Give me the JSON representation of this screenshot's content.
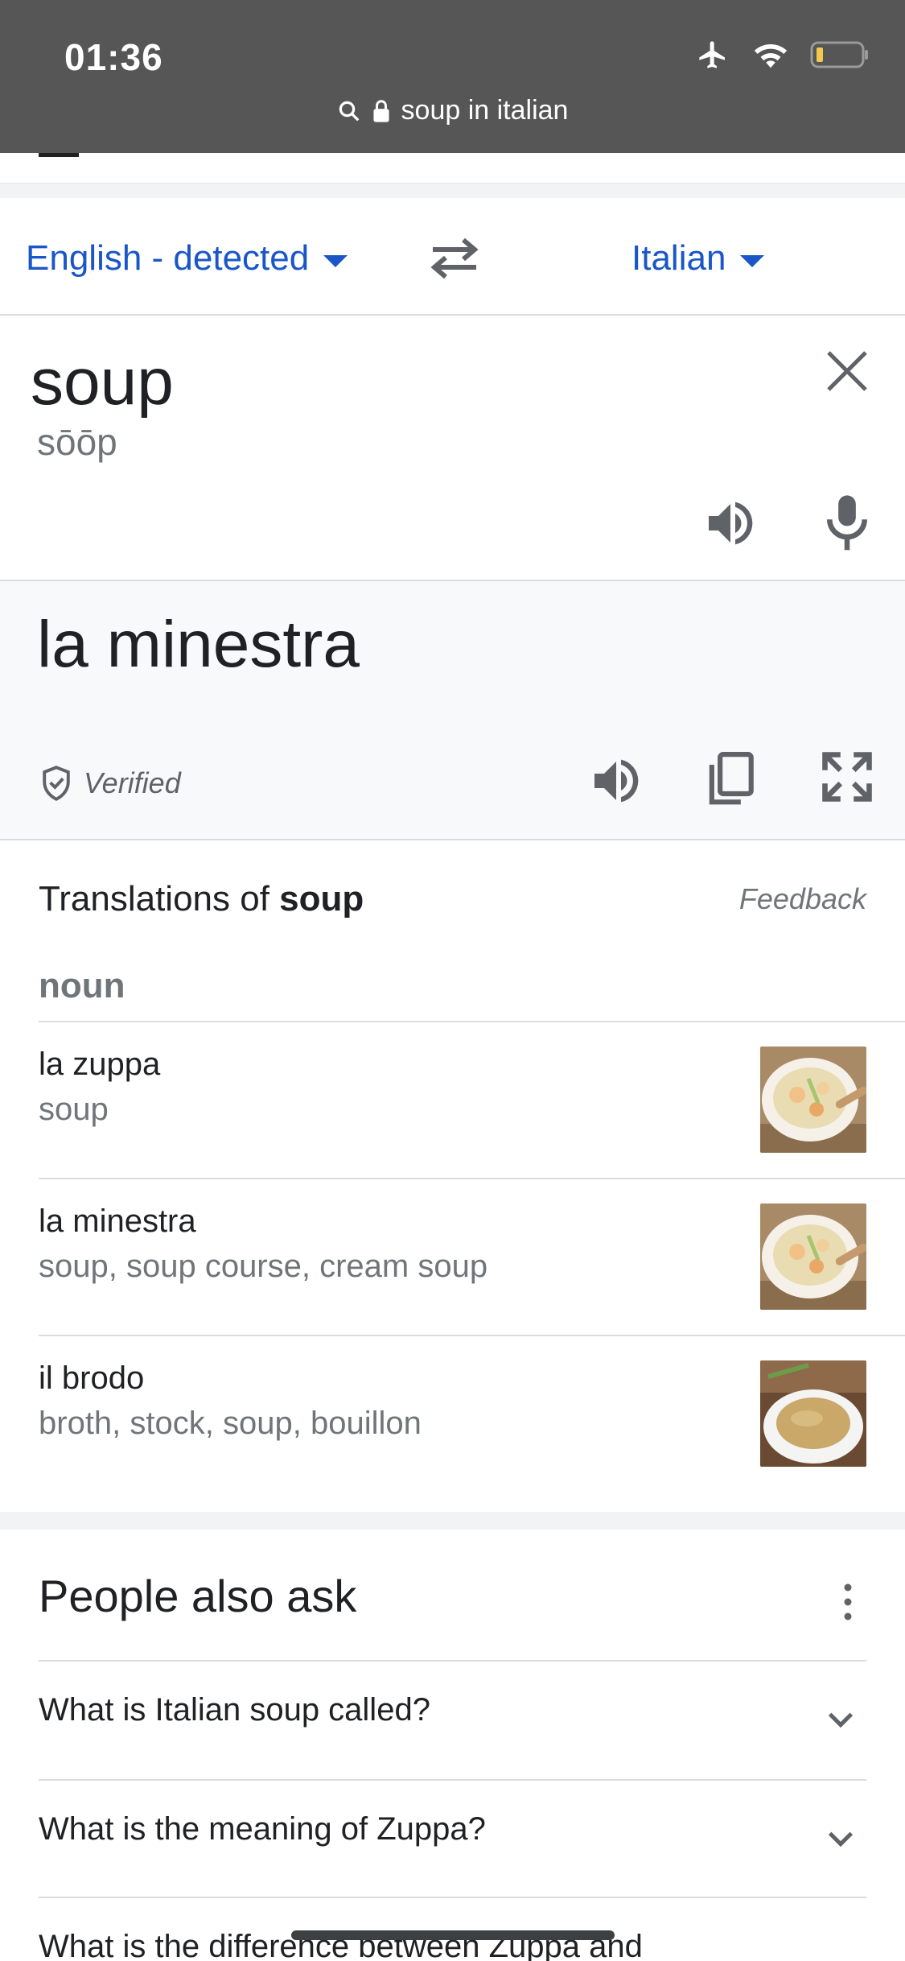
{
  "status_bar": {
    "time": "01:36",
    "url": "soup in italian"
  },
  "language_bar": {
    "source_lang": "English - detected",
    "target_lang": "Italian"
  },
  "source": {
    "text": "soup",
    "phonetic": "sōōp"
  },
  "target": {
    "text": "la minestra",
    "verified_label": "Verified"
  },
  "dictionary": {
    "title_prefix": "Translations of ",
    "title_word": "soup",
    "feedback_label": "Feedback",
    "part_of_speech": "noun",
    "entries": [
      {
        "word": "la zuppa",
        "synonyms": "soup"
      },
      {
        "word": "la minestra",
        "synonyms": "soup, soup course, cream soup"
      },
      {
        "word": "il brodo",
        "synonyms": "broth, stock, soup, bouillon"
      }
    ]
  },
  "people_also_ask": {
    "title": "People also ask",
    "questions": [
      "What is Italian soup called?",
      "What is the meaning of Zuppa?",
      "What is the difference between Zuppa and"
    ]
  },
  "colors": {
    "accent": "#1a56c8",
    "status_bar": "#565656",
    "muted_text": "#70757a"
  }
}
